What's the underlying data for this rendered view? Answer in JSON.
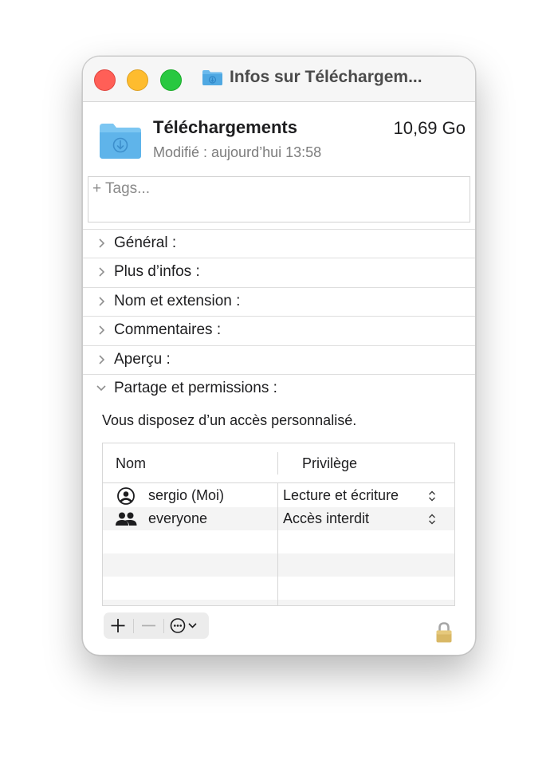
{
  "window": {
    "title": "Infos sur Téléchargem..."
  },
  "file": {
    "name": "Téléchargements",
    "size": "10,69 Go",
    "modified": "Modifié : aujourd’hui 13:58",
    "icon": "downloads-folder-icon"
  },
  "tags": {
    "placeholder": "+ Tags..."
  },
  "sections": [
    {
      "label": "Général :",
      "expanded": false
    },
    {
      "label": "Plus d’infos :",
      "expanded": false
    },
    {
      "label": "Nom et extension :",
      "expanded": false
    },
    {
      "label": "Commentaires :",
      "expanded": false
    },
    {
      "label": "Aperçu :",
      "expanded": false
    },
    {
      "label": "Partage et permissions :",
      "expanded": true
    }
  ],
  "sharing": {
    "access_text": "Vous disposez d’un accès personnalisé.",
    "columns": {
      "name": "Nom",
      "privilege": "Privilège"
    },
    "rows": [
      {
        "name": "sergio (Moi)",
        "privilege": "Lecture et écriture",
        "icon": "user-circle-icon"
      },
      {
        "name": "everyone",
        "privilege": "Accès interdit",
        "icon": "group-icon"
      }
    ]
  },
  "toolbar": {
    "add": "plus-icon",
    "remove": "minus-icon",
    "more": "ellipsis-circle-icon"
  },
  "colors": {
    "close": "#ff5f57",
    "minimize": "#febc2e",
    "zoom": "#28c840",
    "folder": "#5fb4ea"
  }
}
